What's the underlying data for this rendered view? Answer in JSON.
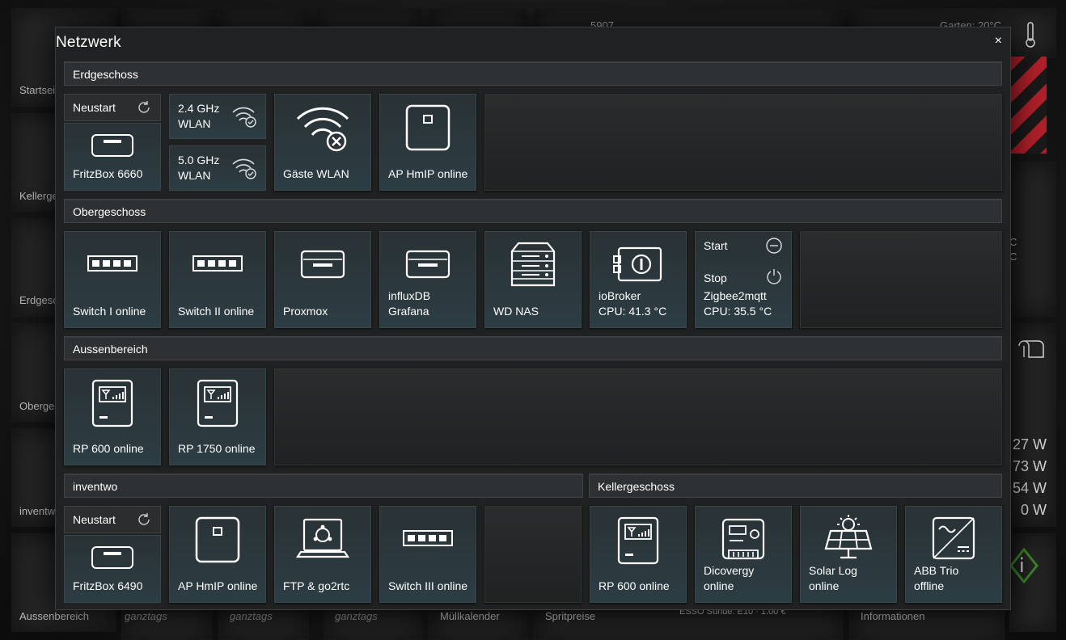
{
  "background": {
    "left_labels": [
      "Startsei",
      "Kellerge",
      "Erdgesc",
      "Oberge",
      "inventw",
      "Aussenbereich"
    ],
    "bottom_labels": [
      "ganztags",
      "ganztags",
      "ganztags",
      "Müllkalender",
      "Spritpreise",
      "ESSO Sünde: E10 · 1.00 €",
      "Informationen"
    ],
    "top_number": "5907",
    "garden": "Garten:  20°C",
    "right_values": [
      "27 W",
      "73 W",
      "54 W",
      "0 W"
    ],
    "right_temps": [
      "C",
      "C"
    ]
  },
  "dialog": {
    "title": "Netzwerk",
    "close": "×"
  },
  "sections": {
    "erdgeschoss": "Erdgeschoss",
    "obergeschoss": "Obergeschoss",
    "aussenbereich": "Aussenbereich",
    "inventwo": "inventwo",
    "kellergeschoss": "Kellergeschoss"
  },
  "tiles": {
    "neustart1": "Neustart",
    "fritzbox6660": "FritzBox 6660",
    "wlan24_line1": "2.4 GHz",
    "wlan24_line2": "WLAN",
    "wlan50_line1": "5.0 GHz",
    "wlan50_line2": "WLAN",
    "gaeste_wlan": "Gäste WLAN",
    "ap_hmip_1": "AP HmIP online",
    "switch1": "Switch I online",
    "switch2": "Switch II online",
    "proxmox": "Proxmox",
    "influx_line1": "influxDB",
    "influx_line2": "Grafana",
    "wd_nas": "WD NAS",
    "iobroker_line1": "ioBroker",
    "iobroker_line2": "CPU: 41.3 °C",
    "start": "Start",
    "stop": "Stop",
    "zigbee_line1": "Zigbee2mqtt",
    "zigbee_line2": "CPU: 35.5 °C",
    "rp600_1": "RP 600 online",
    "rp1750": "RP 1750 online",
    "neustart2": "Neustart",
    "fritzbox6490": "FritzBox 6490",
    "ap_hmip_2": "AP HmIP online",
    "ftp": "FTP & go2rtc",
    "switch3": "Switch III online",
    "rp600_2": "RP 600 online",
    "dicovergy_line1": "Dicovergy",
    "dicovergy_line2": "online",
    "solarlog_line1": "Solar Log",
    "solarlog_line2": "online",
    "abb_line1": "ABB Trio",
    "abb_line2": "offline"
  },
  "icons": [
    "router-icon",
    "wifi-check-icon",
    "wifi-off-icon",
    "access-point-icon",
    "network-switch-icon",
    "server-icon",
    "nas-icon",
    "iobroker-icon",
    "minus-circle-icon",
    "power-icon",
    "repeater-icon",
    "laptop-ubuntu-icon",
    "energy-meter-icon",
    "solar-panel-icon",
    "inverter-icon",
    "refresh-icon"
  ]
}
